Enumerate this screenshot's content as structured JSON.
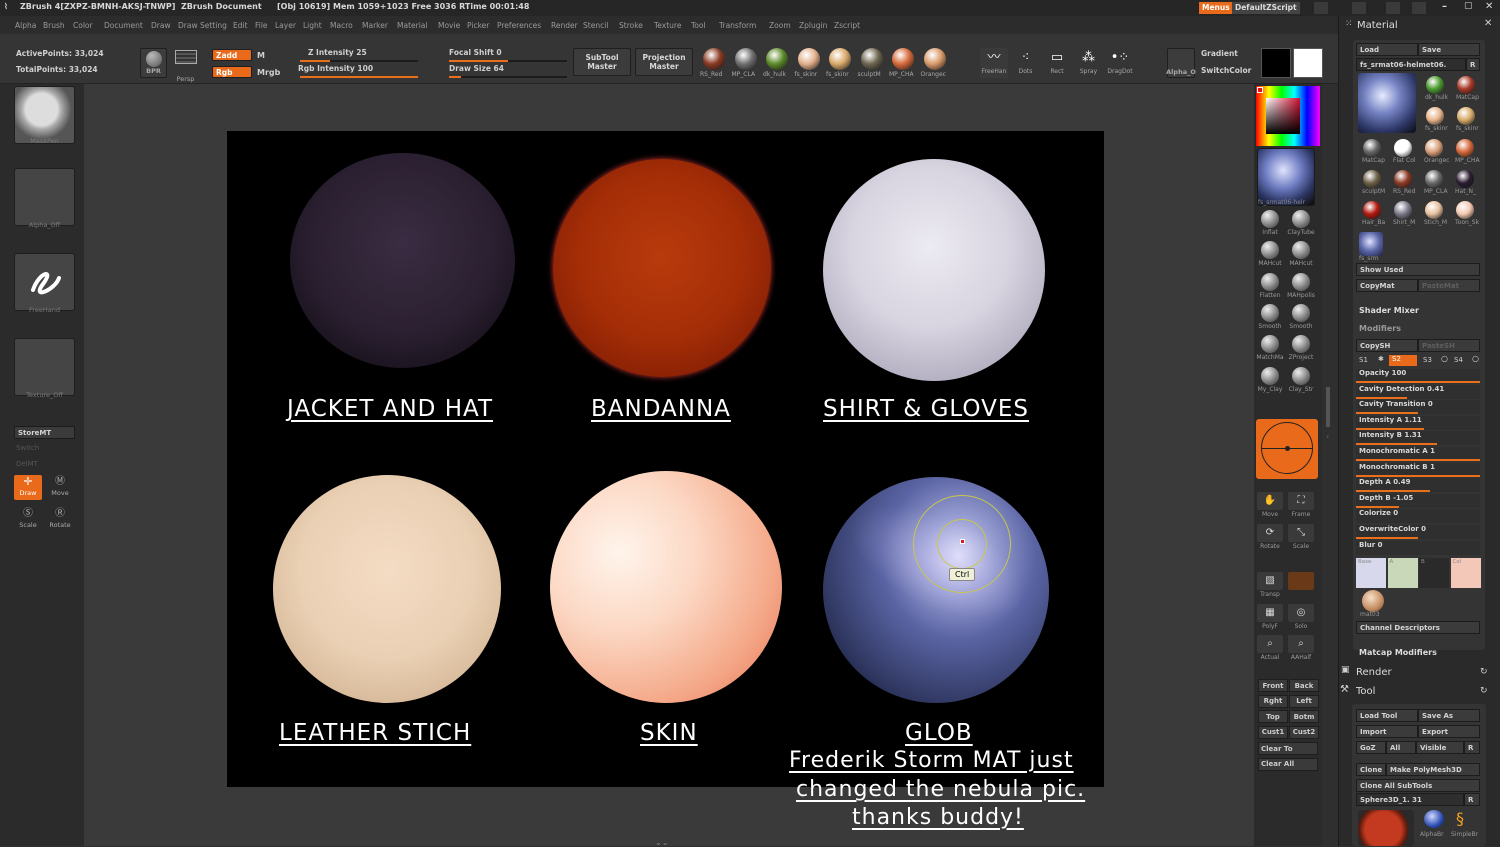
{
  "titlebar": {
    "app": "ZBrush 4[ZXPZ-BMNH-AKSJ-TNWP]",
    "doc": "ZBrush Document",
    "stats": "[Obj 10619] Mem 1059+1023 Free 3036 RTime 00:01:48",
    "menus_btn": "Menus",
    "script_btn": "DefaultZScript"
  },
  "menubar": [
    "Alpha",
    "Brush",
    "Color",
    "Document",
    "Draw",
    "Draw Setting",
    "Edit",
    "File",
    "Layer",
    "Light",
    "Macro",
    "Marker",
    "Material",
    "Movie",
    "Picker",
    "Preferences",
    "Render",
    "Stencil",
    "Stroke",
    "Texture",
    "Tool",
    "Transform",
    "Zoom",
    "Zplugin",
    "Zscript"
  ],
  "shelf": {
    "active_points": "ActivePoints: 33,024",
    "total_points": "TotalPoints: 33,024",
    "bpr": "BPR",
    "persp": "Persp",
    "zadd": "Zadd",
    "zsub": "M",
    "rgb": "Rgb",
    "mrgb": "Mrgb",
    "z_intensity": "Z Intensity 25",
    "z_intensity_value": 0.25,
    "rgb_intensity": "Rgb Intensity 100",
    "rgb_intensity_value": 1.0,
    "focal_shift": "Focal Shift 0",
    "focal_shift_value": 0.5,
    "draw_size": "Draw Size 64",
    "draw_size_value": 0.1,
    "subtool_master": "SubTool Master",
    "projection_master": "Projection Master",
    "materials": [
      {
        "label": "RS_Red",
        "color": "#8a3a22"
      },
      {
        "label": "MP_CLA",
        "color": "#707070"
      },
      {
        "label": "dk_hulk",
        "color": "#5c8a2a"
      },
      {
        "label": "fs_skinr",
        "color": "#e3b08c"
      },
      {
        "label": "fs_skinr",
        "color": "#d9a96b"
      },
      {
        "label": "sculptM",
        "color": "#6d6650"
      },
      {
        "label": "MP_CHA",
        "color": "#d66a3a"
      },
      {
        "label": "Orangec",
        "color": "#d99a6a"
      }
    ],
    "strokes": [
      "FreeHan",
      "Dots",
      "Rect",
      "Spray",
      "DragDot"
    ],
    "alpha": "Alpha_O",
    "gradient": "Gradient",
    "switch_color": "SwitchColor"
  },
  "left": {
    "maskpen": "MaskPen",
    "alpha_off": "Alpha_Off",
    "freehand": "FreeHand",
    "texture_off": "Texture_Off",
    "store_mt": "StoreMT",
    "switch": "Switch",
    "del_mt": "DelMT",
    "draw": "Draw",
    "move": "Move",
    "scale": "Scale",
    "rotate": "Rotate"
  },
  "spheres": [
    {
      "label": "JACKET AND HAT"
    },
    {
      "label": "BANDANNA"
    },
    {
      "label": "SHIRT & GLOVES"
    },
    {
      "label": "LEATHER STICH"
    },
    {
      "label": "SKIN"
    },
    {
      "label": "GLOB"
    }
  ],
  "comment": [
    "Frederik Storm MAT just",
    "changed the nebula pic.",
    "thanks buddy!"
  ],
  "ctrl_tip": "Ctrl",
  "rshelf": {
    "current_mat": "fs_srmat06-helr",
    "brushes": [
      "Inflat",
      "ClayTube",
      "MAHcut",
      "MAHcut",
      "Flatten",
      "MAHpolis",
      "Smooth",
      "Smooth",
      "MatchMa",
      "ZProject",
      "My_Clay",
      "Clay_Str"
    ],
    "nav": [
      "Move",
      "Frame",
      "Rotate",
      "Scale",
      "Transp",
      "",
      "PolyF",
      "Solo",
      "Actual",
      "AAHalf"
    ],
    "views": [
      "Front",
      "Back",
      "Rght",
      "Left",
      "Top",
      "Botm",
      "Cust1",
      "Cust2",
      "Clear To",
      "Clear All"
    ]
  },
  "panel": {
    "title": "Material",
    "load": "Load",
    "save": "Save",
    "matname": "fs_srmat06-helmet06.",
    "r": "R",
    "mats": [
      {
        "label": "dk_hulk",
        "color": "#4c9a30"
      },
      {
        "label": "MatCap",
        "color": "#a83a2a"
      },
      {
        "label": "fs_skinr",
        "color": "#e7b48c"
      },
      {
        "label": "fs_skinr",
        "color": "#d7ab6a"
      },
      {
        "label": "MatCap",
        "color": "#666"
      },
      {
        "label": "Flat Col",
        "color": "#ffffff"
      },
      {
        "label": "Orangec",
        "color": "#d9a07a"
      },
      {
        "label": "MP_CHA",
        "color": "#d6683a"
      },
      {
        "label": "sculptM",
        "color": "#6e6248"
      },
      {
        "label": "RS_Red",
        "color": "#8e3a24"
      },
      {
        "label": "MP_CLA",
        "color": "#6a6a6a"
      },
      {
        "label": "Hat_N_",
        "color": "#2a1d30"
      },
      {
        "label": "Hair_Ba",
        "color": "#b41a10"
      },
      {
        "label": "Shirt_M",
        "color": "#7d7a8a"
      },
      {
        "label": "Stich_M",
        "color": "#e8c0a0"
      },
      {
        "label": "Toon_Sk",
        "color": "#f4c8b0"
      }
    ],
    "fs_srm": "fs_srm",
    "show_used": "Show Used",
    "copymat": "CopyMat",
    "pastemat": "PasteMat",
    "shader_mixer": "Shader Mixer",
    "modifiers": "Modifiers",
    "copysh": "CopySH",
    "pastesh": "PasteSH",
    "s1": "S1",
    "s2": "S2",
    "s3": "S3",
    "s4": "S4",
    "sliders": [
      {
        "label": "Opacity 100",
        "v": 1.0
      },
      {
        "label": "Cavity Detection 0.41",
        "v": 0.41
      },
      {
        "label": "Cavity Transition 0",
        "v": 0.5
      },
      {
        "label": "Intensity A 1.11",
        "v": 0.55
      },
      {
        "label": "Intensity B 1.31",
        "v": 0.65
      },
      {
        "label": "Monochromatic A 1",
        "v": 1.0
      },
      {
        "label": "Monochromatic B 1",
        "v": 1.0
      },
      {
        "label": "Depth A 0.49",
        "v": 0.6
      },
      {
        "label": "Depth B -1.05",
        "v": 0.35
      },
      {
        "label": "Colorize 0",
        "v": 0.0
      },
      {
        "label": "OverwriteColor 0",
        "v": 0.5
      },
      {
        "label": "Blur 0",
        "v": 0.0
      }
    ],
    "swatches": [
      {
        "label": "Base",
        "color": "#d8d8ec"
      },
      {
        "label": "A",
        "color": "#c8d8b8"
      },
      {
        "label": "B",
        "color": "#2a2a2a"
      },
      {
        "label": "Col",
        "color": "#f4c8b8"
      }
    ],
    "mat03": "mat03",
    "channel_descriptors": "Channel Descriptors",
    "matcap_modifiers": "Matcap Modifiers",
    "render": "Render",
    "tool": "Tool",
    "load_tool": "Load Tool",
    "save_as": "Save As",
    "import": "Import",
    "export": "Export",
    "goz": "GoZ",
    "all": "All",
    "visible": "Visible",
    "r2": "R",
    "clone": "Clone",
    "make_polymesh": "Make PolyMesh3D",
    "clone_all": "Clone All SubTools",
    "sphere3d": "Sphere3D_1. 31",
    "alphabr": "AlphaBr",
    "simplebr": "SimpleBr"
  }
}
